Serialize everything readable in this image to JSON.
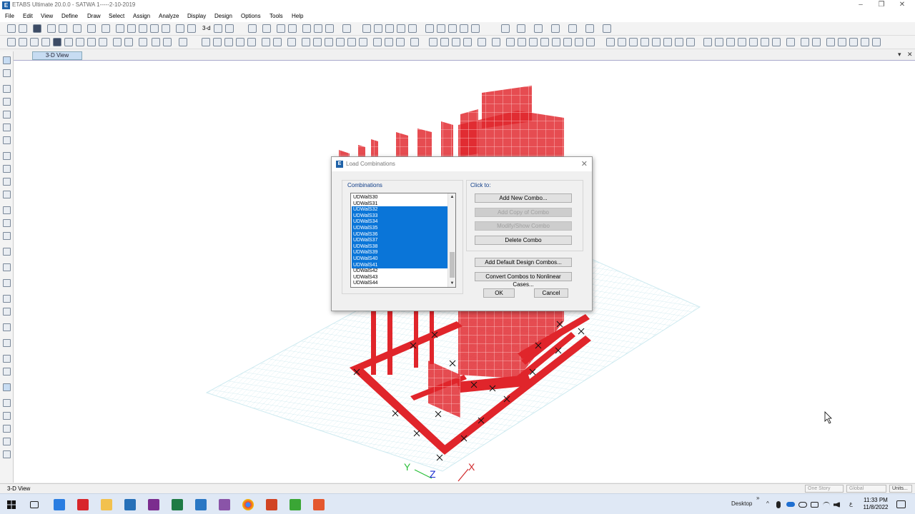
{
  "window": {
    "title": "ETABS Ultimate 20.0.0 - SATWA 1-----2-10-2019",
    "app_icon_letter": "E",
    "min_glyph": "–",
    "max_glyph": "❐",
    "close_glyph": "✕"
  },
  "menu": [
    "File",
    "Edit",
    "View",
    "Define",
    "Draw",
    "Select",
    "Assign",
    "Analyze",
    "Display",
    "Design",
    "Options",
    "Tools",
    "Help"
  ],
  "toolbar": {
    "three_d_label": "3-d"
  },
  "view_tab": {
    "label": "3-D View",
    "collapse_glyph": "▾",
    "close_glyph": "✕"
  },
  "axes": {
    "x": "X",
    "y": "Y",
    "z": "Z"
  },
  "status_bar": {
    "left_text": "3-D View",
    "story_dropdown": "One Story",
    "coord_dropdown": "Global",
    "units_button": "Units..."
  },
  "taskbar": {
    "desktop_label": "Desktop",
    "chevron": "»",
    "tray_overflow": "^",
    "ime": "ع",
    "time": "11:33 PM",
    "date": "11/8/2022"
  },
  "dialog": {
    "title": "Load Combinations",
    "icon_letter": "E",
    "close_glyph": "✕",
    "combinations_label": "Combinations",
    "click_to_label": "Click to:",
    "scroll_up": "▲",
    "scroll_down": "▼",
    "items": [
      {
        "label": "UDWalS30",
        "selected": false
      },
      {
        "label": "UDWalS31",
        "selected": false
      },
      {
        "label": "UDWalS32",
        "selected": true
      },
      {
        "label": "UDWalS33",
        "selected": true
      },
      {
        "label": "UDWalS34",
        "selected": true
      },
      {
        "label": "UDWalS35",
        "selected": true
      },
      {
        "label": "UDWalS36",
        "selected": true
      },
      {
        "label": "UDWalS37",
        "selected": true
      },
      {
        "label": "UDWalS38",
        "selected": true
      },
      {
        "label": "UDWalS39",
        "selected": true
      },
      {
        "label": "UDWalS40",
        "selected": true
      },
      {
        "label": "UDWalS41",
        "selected": true
      },
      {
        "label": "UDWalS42",
        "selected": false
      },
      {
        "label": "UDWalS43",
        "selected": false
      },
      {
        "label": "UDWalS44",
        "selected": false
      }
    ],
    "buttons": {
      "add_new": "Add New Combo...",
      "add_copy": "Add Copy of Combo",
      "modify": "Modify/Show Combo",
      "delete": "Delete Combo",
      "add_default": "Add Default Design Combos...",
      "convert": "Convert Combos to Nonlinear Cases...",
      "ok": "OK",
      "cancel": "Cancel"
    }
  },
  "colors": {
    "accent": "#0a75d8",
    "model_red": "#e0252b",
    "grid": "#b7dfe8"
  }
}
